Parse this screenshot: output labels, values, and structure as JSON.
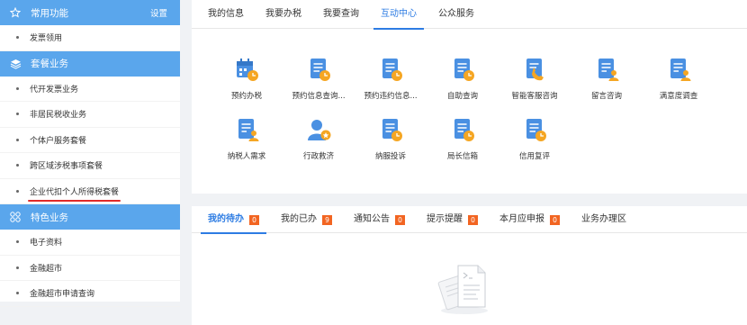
{
  "sidebar": {
    "common": {
      "title": "常用功能",
      "setting": "设置",
      "items": [
        "发票领用"
      ]
    },
    "package": {
      "title": "套餐业务",
      "items": [
        "代开发票业务",
        "非居民税收业务",
        "个体户服务套餐",
        "跨区域涉税事项套餐",
        "企业代扣个人所得税套餐"
      ]
    },
    "special": {
      "title": "特色业务",
      "items": [
        "电子资料",
        "金融超市",
        "金融超市申请查询"
      ]
    }
  },
  "top_tabs": [
    "我的信息",
    "我要办税",
    "我要查询",
    "互动中心",
    "公众服务"
  ],
  "top_active": 3,
  "grid_items": [
    {
      "label": "预约办税",
      "icon": "calendar-clock-icon"
    },
    {
      "label": "预约信息查询...",
      "icon": "doc-clock-icon"
    },
    {
      "label": "预约违约信息...",
      "icon": "doc-clock-icon"
    },
    {
      "label": "自助查询",
      "icon": "doc-clock-icon"
    },
    {
      "label": "智能客服咨询",
      "icon": "phone-doc-icon"
    },
    {
      "label": "留言咨询",
      "icon": "doc-user-icon"
    },
    {
      "label": "满意度调查",
      "icon": "doc-user-icon"
    },
    {
      "label": "纳税人需求",
      "icon": "doc-user-icon"
    },
    {
      "label": "行政救济",
      "icon": "person-badge-icon"
    },
    {
      "label": "纳服投诉",
      "icon": "doc-clock-icon"
    },
    {
      "label": "局长信箱",
      "icon": "doc-clock-icon"
    },
    {
      "label": "信用复评",
      "icon": "doc-clock-icon"
    }
  ],
  "bottom_tabs": [
    {
      "label": "我的待办",
      "badge": "0"
    },
    {
      "label": "我的已办",
      "badge": "9"
    },
    {
      "label": "通知公告",
      "badge": "0"
    },
    {
      "label": "提示提醒",
      "badge": "0"
    },
    {
      "label": "本月应申报",
      "badge": "0"
    },
    {
      "label": "业务办理区",
      "badge": ""
    }
  ],
  "bottom_active": 0,
  "colors": {
    "accent": "#2d7ce3",
    "header": "#5aa6ec",
    "icon": "#4a90e2",
    "clock": "#f5a623",
    "badge": "#f26522",
    "underline": "#e02a2a"
  }
}
